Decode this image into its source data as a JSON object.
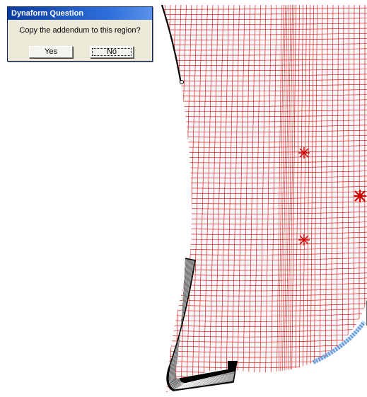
{
  "dialog": {
    "title": "Dynaform Question",
    "message": "Copy the addendum to this region?",
    "yes_label": "Yes",
    "no_label": "No"
  },
  "colors": {
    "mesh": "#d10000",
    "outline": "#000000",
    "blue_band": "#6fa3e0",
    "title_bar": "#0a3c9e",
    "dialog_bg": "#ece9d8"
  }
}
